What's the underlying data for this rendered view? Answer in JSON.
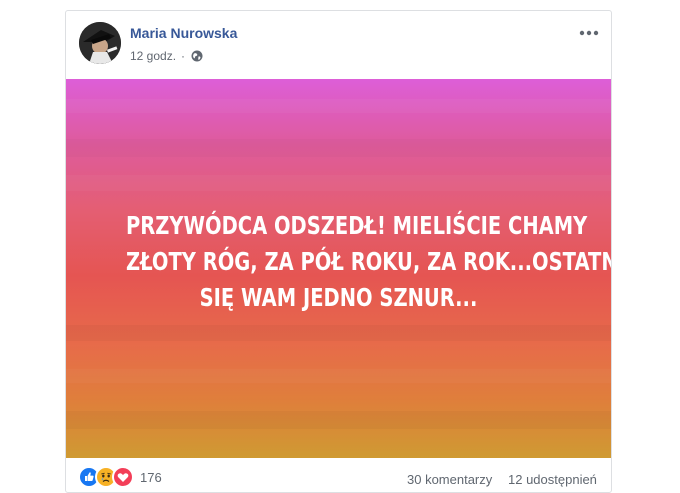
{
  "post": {
    "author": "Maria Nurowska",
    "time": "12 godz.",
    "privacy_icon": "globe-icon",
    "menu_icon": "more-options-icon",
    "text_lines": [
      "PRZYWÓDCA ODSZEDŁ! MIELIŚCIE CHAMY",
      "ZŁOTY RÓG, ZA PÓŁ ROKU, ZA ROK...OSTATNIE",
      "SIĘ WAM JEDNO SZNUR..."
    ],
    "background_gradient": [
      "#dd5ed8",
      "#de5b9d",
      "#e45e72",
      "#e55552",
      "#e76b4a",
      "#df7f3b",
      "#cf9a32"
    ]
  },
  "footer": {
    "reactions": [
      "like",
      "sad",
      "love"
    ],
    "reaction_count": "176",
    "comments": "30 komentarzy",
    "shares": "12 udostępnień"
  }
}
